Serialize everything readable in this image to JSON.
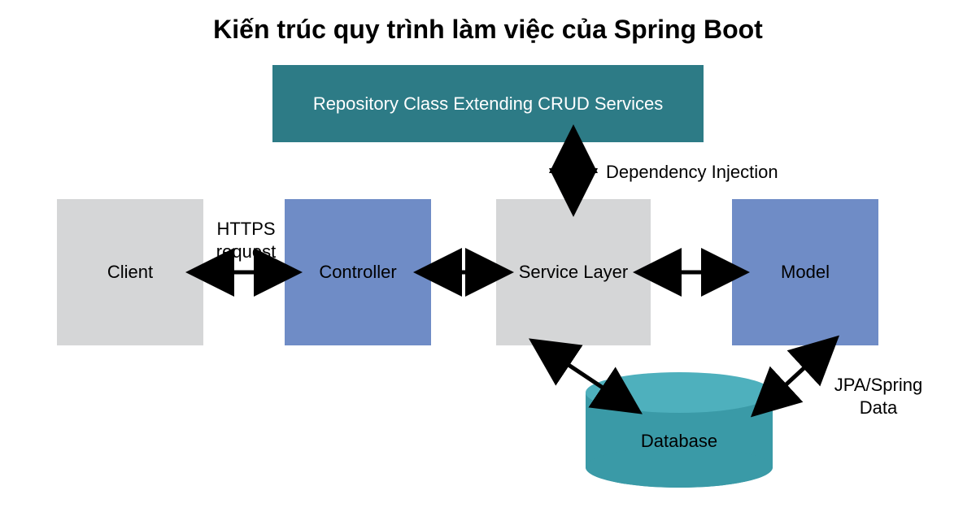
{
  "title": "Kiến trúc quy trình làm việc của Spring Boot",
  "boxes": {
    "repo": "Repository Class Extending CRUD Services",
    "client": "Client",
    "controller": "Controller",
    "service": "Service Layer",
    "model": "Model",
    "database": "Database"
  },
  "annotations": {
    "https_request": "HTTPS request",
    "dependency_injection": "Dependency Injection",
    "jpa_spring_data": "JPA/Spring Data"
  },
  "colors": {
    "gray": "#d5d6d7",
    "blue": "#6f8cc6",
    "teal": "#2d7b86",
    "cyl": "#3a9aa7"
  }
}
